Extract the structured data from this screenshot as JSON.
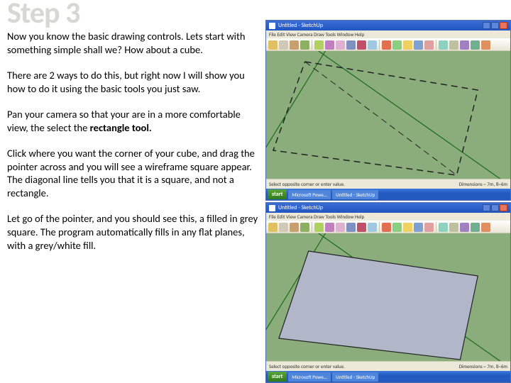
{
  "step": {
    "title": "Step 3",
    "p1": "Now you know the basic drawing controls. Lets start with something simple shall we? How about a cube.",
    "p2": "There are 2 ways to do this, but right now I will show you how to do it using the basic tools you just saw.",
    "p3_a": "Pan your camera so that your are in a more comfortable view, the select the ",
    "p3_b": "rectangle tool.",
    "p4": "Click where you want the corner of your cube, and drag the pointer across and you will see a wireframe square appear. The diagonal line tells you that it is a square, and not a rectangle.",
    "p5": "Let go of the pointer, and you should see this, a filled in grey square. The program automatically fills in any flat planes, with a grey/white fill."
  },
  "window": {
    "title": "Untitled - SketchUp",
    "menubar": "File  Edit  View  Camera  Draw  Tools  Window  Help",
    "status_left": "Select opposite corner or enter value.",
    "status_right_label": "Dimensions",
    "status_right_value": "~ 7m, 8~6m"
  },
  "toolbar_colors": [
    "#e0c060",
    "#d0c8b8",
    "#c8a070",
    "#8ab060",
    "#b0d060",
    "#c080c0",
    "#e0b0d0",
    "#8090c0",
    "#c0506a",
    "#a0c8e0",
    "#e07050",
    "#88d080",
    "#f0d060",
    "#80a0d0",
    "#e0a0a0",
    "#90d0c0",
    "#c0c0a0",
    "#a080c0",
    "#70b090",
    "#e09060"
  ],
  "taskbar": {
    "start": "start",
    "task1": "Microsoft Powe...",
    "task2": "Untitled - SketchUp"
  }
}
